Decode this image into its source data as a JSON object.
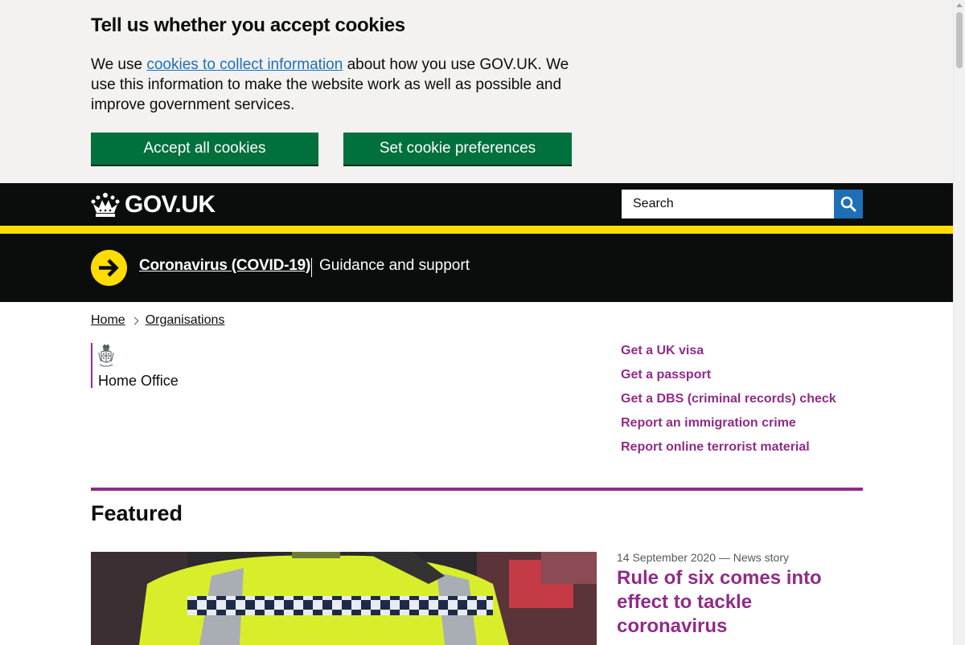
{
  "cookie_banner": {
    "title": "Tell us whether you accept cookies",
    "text_before": "We use ",
    "link_text": "cookies to collect information",
    "text_after": " about how you use GOV.UK. We use this information to make the website work as well as possible and improve government services.",
    "accept_label": "Accept all cookies",
    "preferences_label": "Set cookie preferences",
    "background_color": "#f3f2f1",
    "button_color": "#00703c"
  },
  "header": {
    "logo_text": "GOV.UK",
    "logo_icon": "crown-icon",
    "search_placeholder": "Search",
    "search_icon": "search-icon",
    "background_color": "#0b0c0c",
    "stripe_color": "#ffdd00"
  },
  "covid_banner": {
    "icon": "arrow-circle-icon",
    "link_text": "Coronavirus (COVID-19)",
    "description": "Guidance and support"
  },
  "breadcrumb": [
    {
      "label": "Home"
    },
    {
      "label": "Organisations"
    }
  ],
  "organisation": {
    "name": "Home Office",
    "icon": "royal-crest-icon",
    "brand_color": "#9325b2"
  },
  "quick_links": [
    {
      "label": "Get a UK visa"
    },
    {
      "label": "Get a passport"
    },
    {
      "label": "Get a DBS (criminal records) check"
    },
    {
      "label": "Report an immigration crime"
    },
    {
      "label": "Report online terrorist material"
    }
  ],
  "featured": {
    "heading": "Featured",
    "items": [
      {
        "meta": "14 September 2020 — News story",
        "title": "Rule of six comes into effect to tackle coronavirus",
        "image": "police-officer-hi-vis-jacket-photo"
      }
    ],
    "link_color": "#912b88"
  }
}
